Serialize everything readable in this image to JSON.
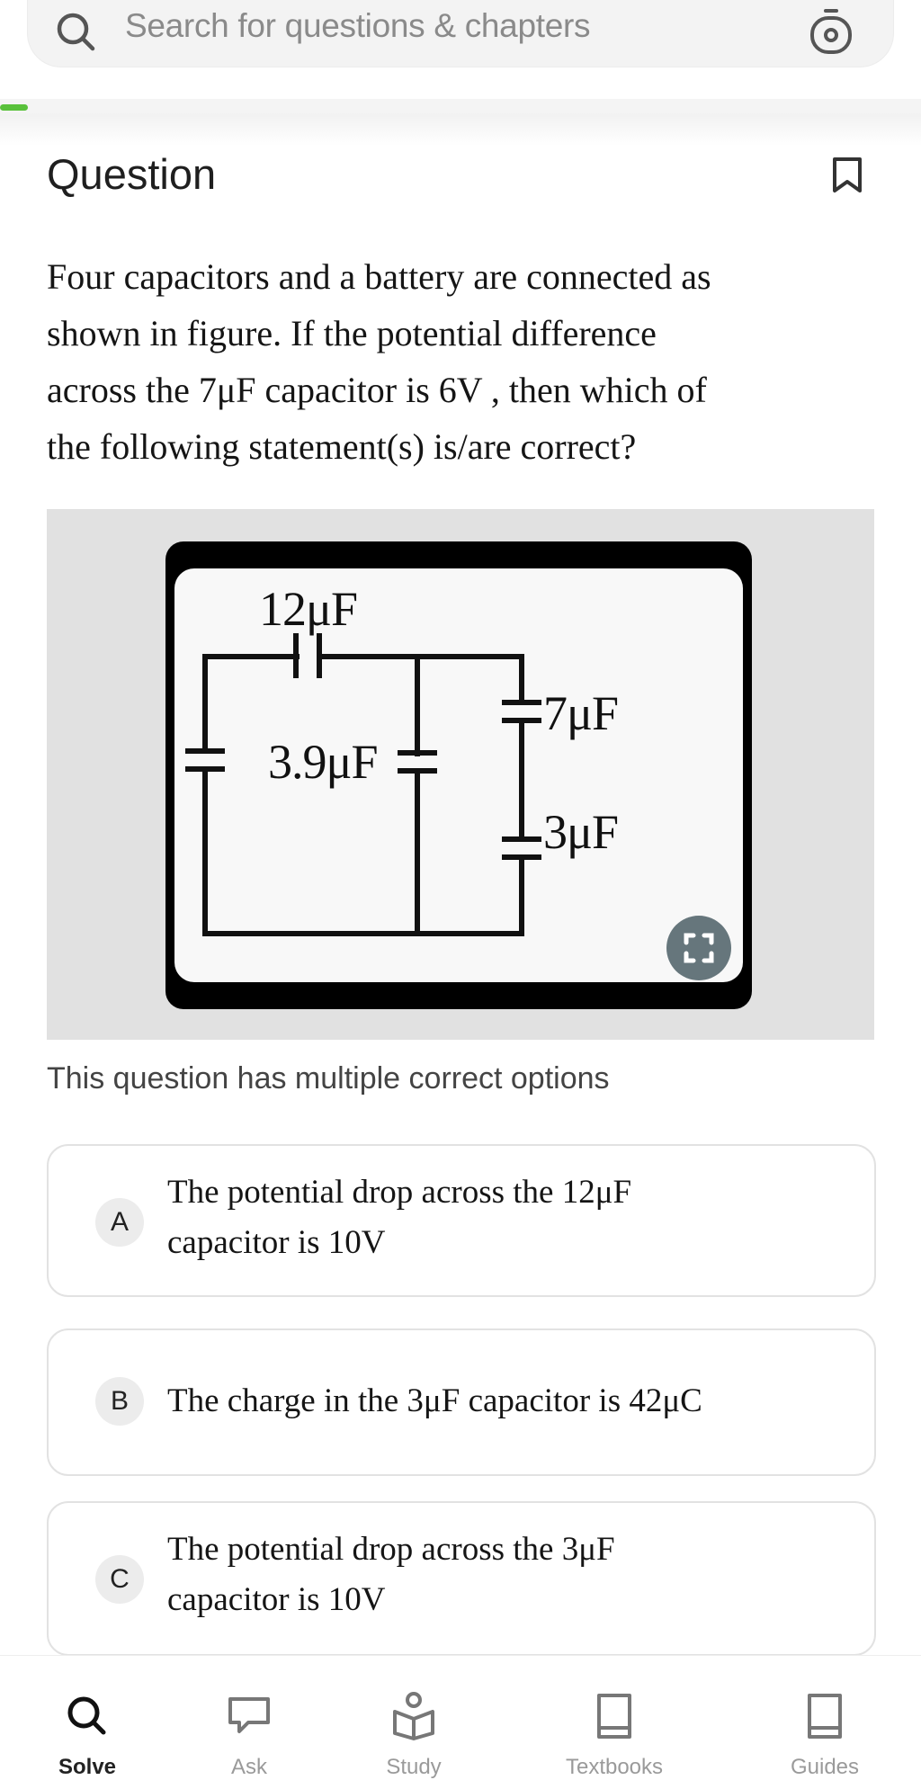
{
  "search": {
    "placeholder": "Search for questions & chapters",
    "icon": "search-icon",
    "camera_icon": "camera-icon"
  },
  "progress": {
    "fraction": 0.03,
    "color": "#59c13b"
  },
  "header": {
    "title": "Question",
    "bookmark_icon": "bookmark-icon"
  },
  "question": {
    "lines": [
      "Four capacitors and a battery are connected as",
      "shown in figure. If the potential difference",
      "across the 7μF capacitor is 6V , then which of",
      "the following statement(s) is/are correct?"
    ]
  },
  "figure": {
    "labels": {
      "c12": "12μF",
      "c39": "3.9μF",
      "c7": "7μF",
      "c3": "3μF"
    },
    "expand_icon": "expand-icon"
  },
  "note": "This question has multiple correct options",
  "options": [
    {
      "letter": "A",
      "lines": [
        "The potential drop across the 12μF",
        "capacitor is 10V"
      ]
    },
    {
      "letter": "B",
      "lines": [
        "The charge in the 3μF capacitor is 42μC"
      ]
    },
    {
      "letter": "C",
      "lines": [
        "The potential drop across the 3μF",
        "capacitor is 10V"
      ]
    }
  ],
  "nav": [
    {
      "label": "Solve",
      "icon": "search-icon",
      "active": true
    },
    {
      "label": "Ask",
      "icon": "chat-icon",
      "active": false
    },
    {
      "label": "Study",
      "icon": "study-icon",
      "active": false
    },
    {
      "label": "Textbooks",
      "icon": "book-icon",
      "active": false
    },
    {
      "label": "Guides",
      "icon": "guide-icon",
      "active": false
    }
  ]
}
